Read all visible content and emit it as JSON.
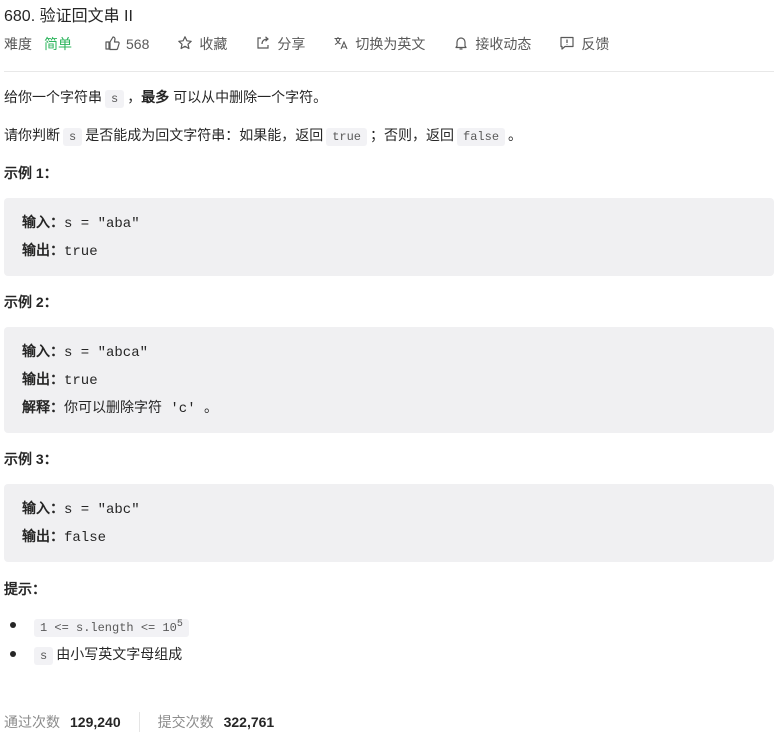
{
  "problem": {
    "title": "680. 验证回文串 II"
  },
  "meta": {
    "difficulty_label": "难度",
    "difficulty": "简单",
    "likes": "568",
    "favorite": "收藏",
    "share": "分享",
    "switch_lang": "切换为英文",
    "subscribe": "接收动态",
    "feedback": "反馈",
    "colors": {
      "difficulty": "#2db55d"
    }
  },
  "description": {
    "p1_a": "给你一个字符串",
    "p1_code": "s",
    "p1_b": "，",
    "p1_bold": "最多",
    "p1_c": "可以从中删除一个字符。",
    "p2_a": "请你判断",
    "p2_code": "s",
    "p2_b": "是否能成为回文字符串：如果能，返回",
    "p2_code_true": "true",
    "p2_c": "；否则，返回",
    "p2_code_false": "false",
    "p2_d": "。"
  },
  "examples": [
    {
      "title": "示例 1：",
      "input_label": "输入：",
      "input": "s = \"aba\"",
      "output_label": "输出：",
      "output": "true"
    },
    {
      "title": "示例 2：",
      "input_label": "输入：",
      "input": "s = \"abca\"",
      "output_label": "输出：",
      "output": "true",
      "explain_label": "解释：",
      "explain": "你可以删除字符 'c' 。"
    },
    {
      "title": "示例 3：",
      "input_label": "输入：",
      "input": "s = \"abc\"",
      "output_label": "输出：",
      "output": "false"
    }
  ],
  "constraints": {
    "title": "提示：",
    "c1_code": "1 <= s.length <= 10",
    "c1_sup": "5",
    "c2_code": "s",
    "c2_text": "由小写英文字母组成"
  },
  "footer": {
    "accepted_label": "通过次数",
    "accepted": "129,240",
    "submissions_label": "提交次数",
    "submissions": "322,761"
  }
}
